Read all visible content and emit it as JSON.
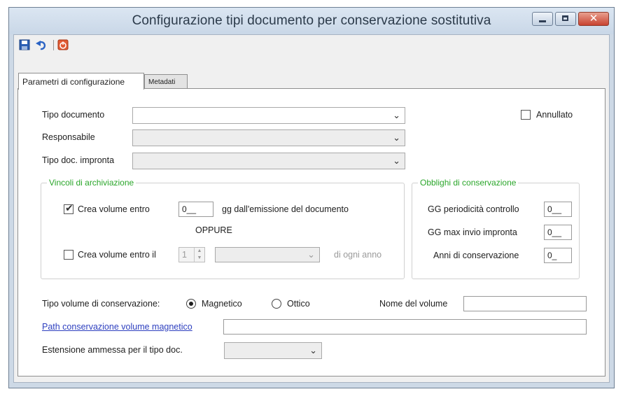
{
  "window": {
    "title": "Configurazione tipi documento per conservazione sostitutiva",
    "minimize_glyph": "",
    "maximize_glyph": "",
    "close_glyph": "✕"
  },
  "toolbar": {
    "icons": [
      "save-icon",
      "undo-icon",
      "exit-icon"
    ]
  },
  "tabs": [
    {
      "label": "Parametri di configurazione",
      "active": true
    },
    {
      "label": "Metadati",
      "active": false
    }
  ],
  "form": {
    "tipo_documento": {
      "label": "Tipo documento",
      "value": ""
    },
    "responsabile": {
      "label": "Responsabile",
      "value": ""
    },
    "tipo_doc_impronta": {
      "label": "Tipo doc. impronta",
      "value": ""
    },
    "annullato": {
      "label": "Annullato",
      "checked": false
    }
  },
  "vincoli": {
    "title": "Vincoli di archiviazione",
    "crea_volume": {
      "label": "Crea volume entro",
      "checked": true,
      "value": "0__",
      "suffix": "gg dall'emissione del documento"
    },
    "oppure": "OPPURE",
    "crea_volume_il": {
      "label": "Crea volume entro il",
      "checked": false,
      "spin_value": "1",
      "combo_value": "",
      "suffix": "di ogni anno"
    }
  },
  "obblighi": {
    "title": "Obblighi di conservazione",
    "rows": [
      {
        "label": "GG periodicità controllo",
        "value": "0__"
      },
      {
        "label": "GG max invio impronta",
        "value": "0__"
      },
      {
        "label": "Anni di conservazione",
        "value": "0_"
      }
    ]
  },
  "tipo_volume": {
    "label": "Tipo volume di conservazione:",
    "options": [
      {
        "label": "Magnetico",
        "selected": true
      },
      {
        "label": "Ottico",
        "selected": false
      }
    ],
    "nome_label": "Nome del volume",
    "nome_value": ""
  },
  "path": {
    "label": "Path conservazione volume magnetico",
    "value": ""
  },
  "estensione": {
    "label": "Estensione ammessa per il tipo doc.",
    "value": ""
  },
  "colors": {
    "group_title": "#2aa62a",
    "link": "#2d3fbf",
    "close_button": "#c84331"
  }
}
